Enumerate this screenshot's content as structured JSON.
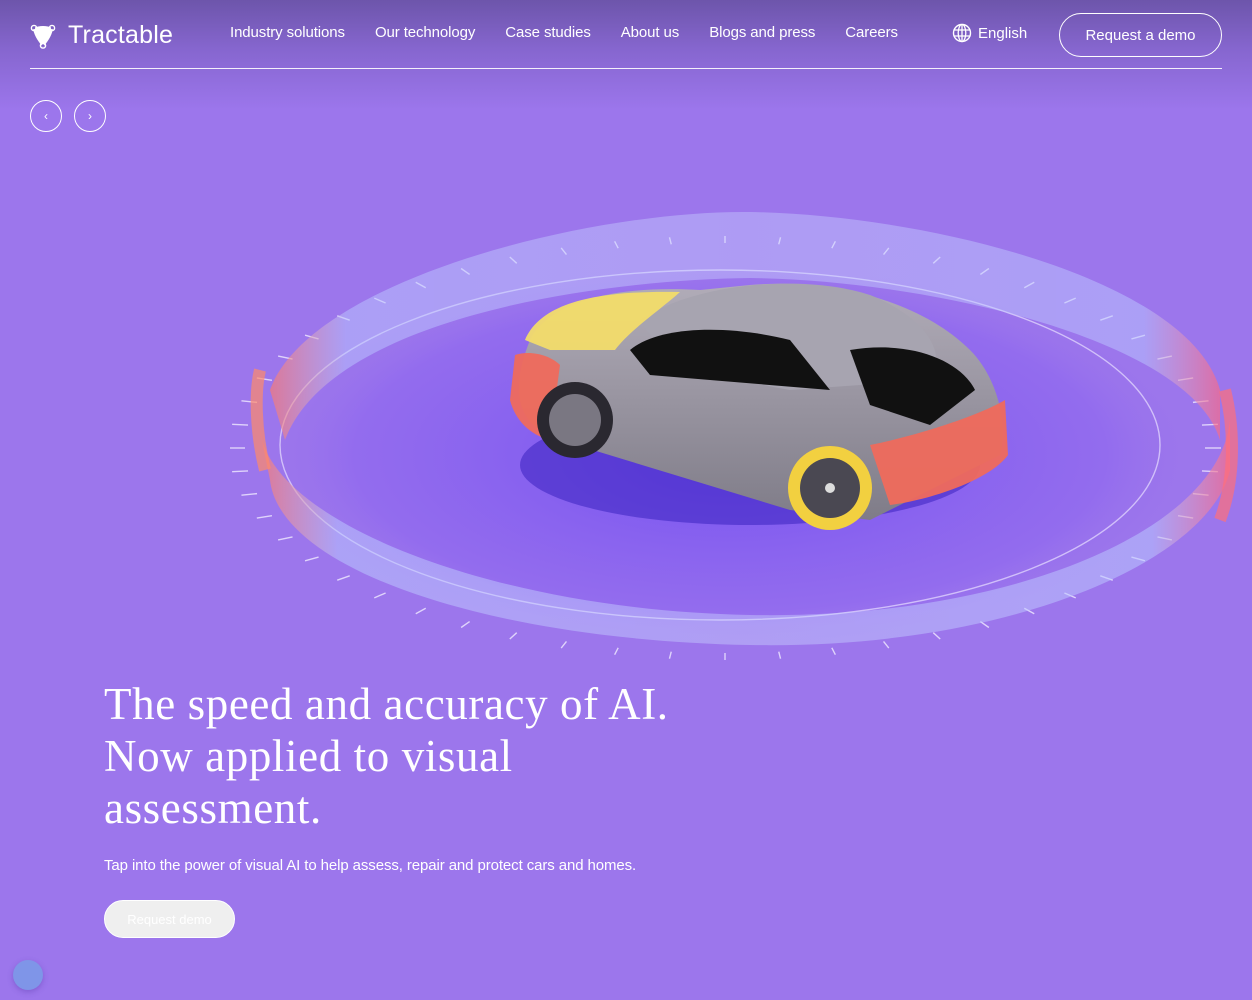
{
  "brand": {
    "name": "Tractable",
    "logo_icon": "tractable-shield-icon",
    "colors": {
      "background": "#9c76ec",
      "header_shade": "#6d55ab",
      "text": "#ffffff",
      "chat_bubble": "#7f95e8",
      "highlight_yellow": "#f2dc6a",
      "highlight_red": "#ef6a5c"
    }
  },
  "nav": {
    "items": [
      {
        "label": "Industry solutions"
      },
      {
        "label": "Our technology"
      },
      {
        "label": "Case studies"
      },
      {
        "label": "About us"
      },
      {
        "label": "Blogs and press"
      },
      {
        "label": "Careers"
      }
    ],
    "language": {
      "icon": "globe-icon",
      "label": "English"
    },
    "cta_label": "Request a demo"
  },
  "carousel": {
    "prev_icon": "chevron-left-icon",
    "next_icon": "chevron-right-icon",
    "prev_glyph": "‹",
    "next_glyph": "›"
  },
  "hero": {
    "title_lines": [
      "The speed and accuracy of AI.",
      "Now applied to visual",
      "assessment."
    ],
    "subtitle": "Tap into the power of visual AI to help assess, repair and protect cars and homes.",
    "button_label": "Request demo",
    "illustration": "car-damage-assessment-illustration"
  },
  "chat": {
    "icon": "chat-bubble-icon"
  }
}
